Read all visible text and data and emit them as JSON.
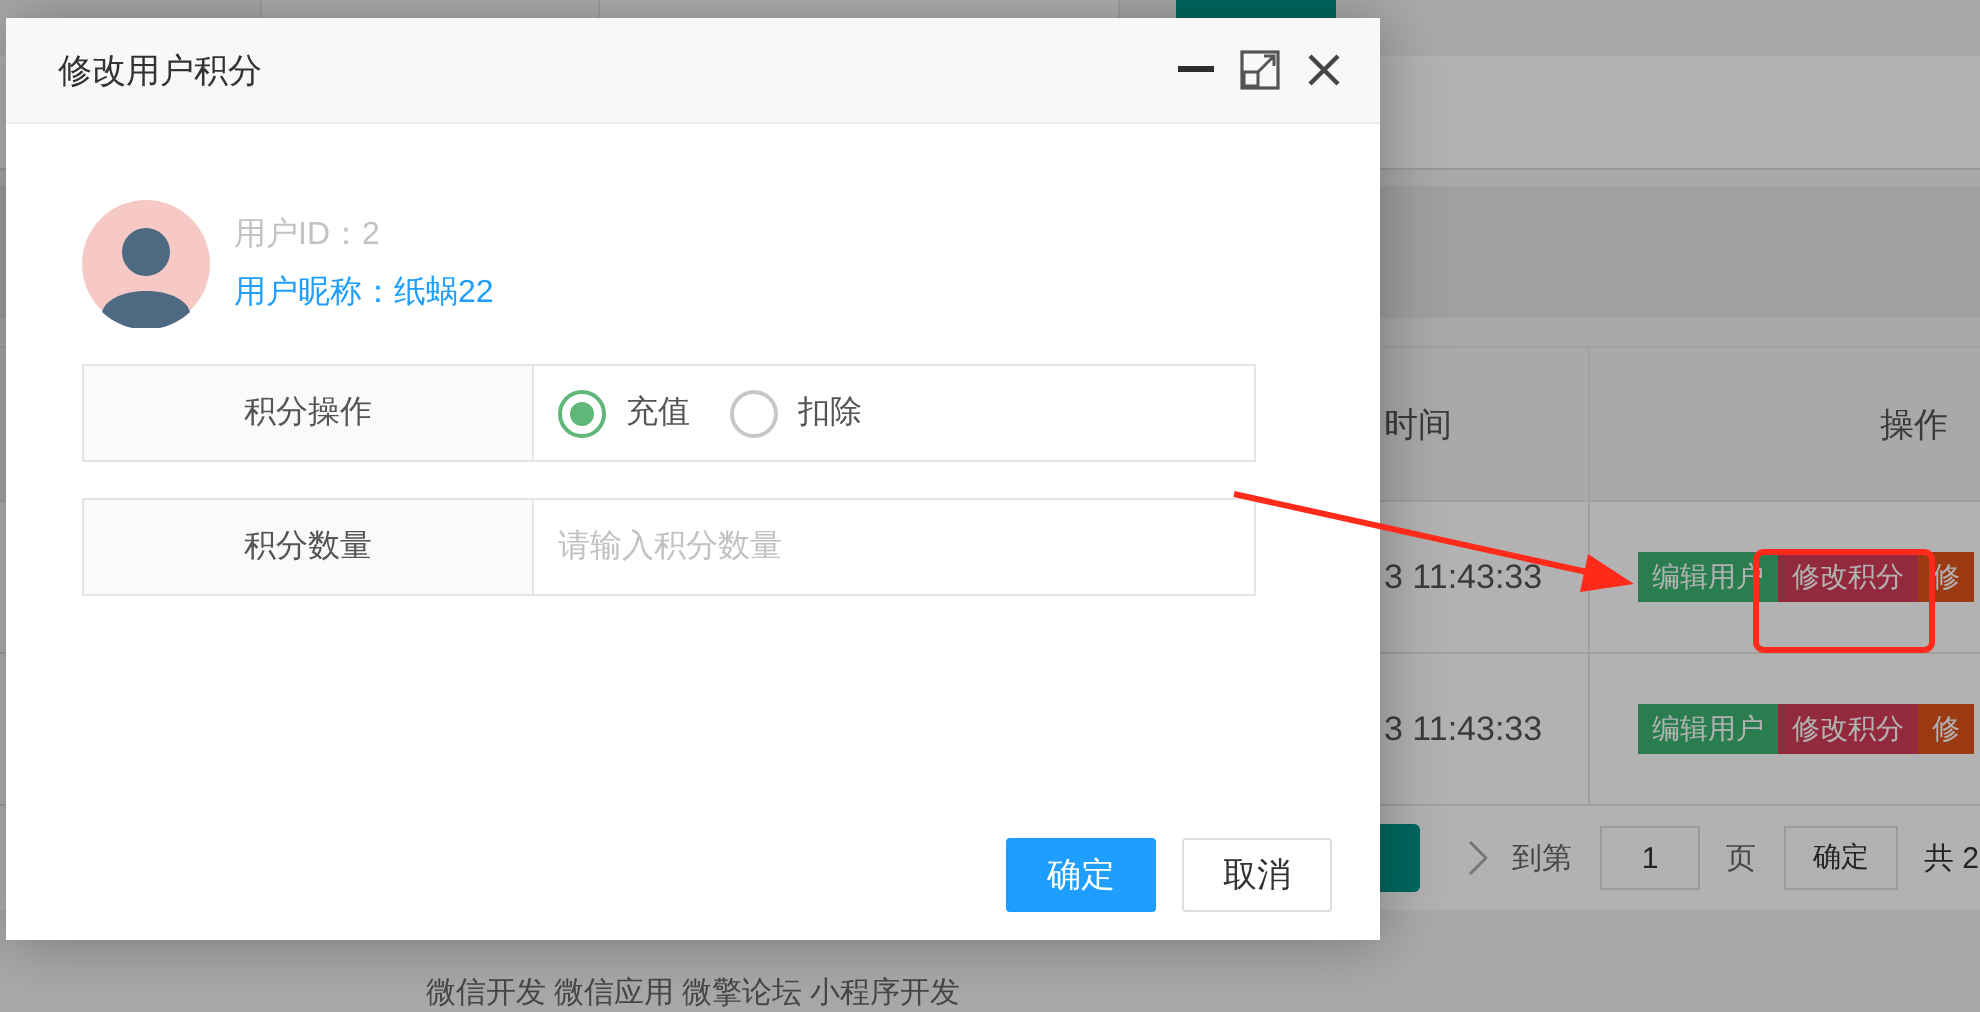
{
  "background_page": {
    "table": {
      "columns": [
        "时间",
        "操作"
      ],
      "rows": [
        {
          "time": "3 11:43:33",
          "actions": [
            {
              "label": "编辑用户",
              "kind": "edit"
            },
            {
              "label": "修改积分",
              "kind": "points"
            },
            {
              "label": "修",
              "kind": "other"
            }
          ]
        },
        {
          "time": "3 11:43:33",
          "actions": [
            {
              "label": "编辑用户",
              "kind": "edit"
            },
            {
              "label": "修改积分",
              "kind": "points"
            },
            {
              "label": "修",
              "kind": "other"
            }
          ]
        }
      ]
    },
    "pagination": {
      "goto_label": "到第",
      "page_value": "1",
      "page_unit": "页",
      "confirm": "确定",
      "total": "共 2"
    },
    "footer_links": [
      "微信开发",
      "微信应用",
      "微擎论坛",
      "小程序开发"
    ]
  },
  "dialog": {
    "title": "修改用户积分",
    "user_id": "用户ID：2",
    "nickname": "用户昵称：纸蜗22",
    "operation": {
      "label": "积分操作",
      "options": [
        {
          "label": "充值",
          "selected": true
        },
        {
          "label": "扣除",
          "selected": false
        }
      ]
    },
    "amount": {
      "label": "积分数量",
      "placeholder": "请输入积分数量"
    },
    "buttons": [
      {
        "label": "确定",
        "kind": "primary"
      },
      {
        "label": "取消",
        "kind": "secondary"
      }
    ]
  }
}
